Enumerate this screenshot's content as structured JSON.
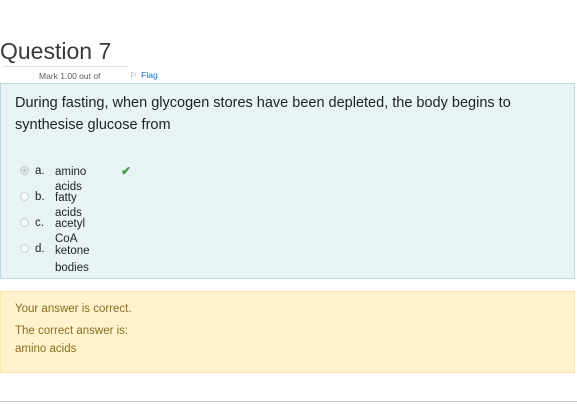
{
  "question": {
    "title": "Question 7",
    "mark": "Mark 1.00 out of",
    "flag_label": "Flag",
    "text": "During fasting, when glycogen stores have been depleted, the body begins to synthesise glucose from"
  },
  "answers": [
    {
      "letter": "a.",
      "text": "amino acids",
      "selected": true,
      "correct": true
    },
    {
      "letter": "b.",
      "text": "fatty acids",
      "selected": false
    },
    {
      "letter": "c.",
      "text": "acetyl CoA",
      "selected": false
    },
    {
      "letter": "d.",
      "text": "ketone bodies",
      "selected": false
    }
  ],
  "feedback": {
    "status": "Your answer is correct.",
    "correct_label": "The correct answer is:",
    "correct_value": "amino acids"
  },
  "colors": {
    "question_bg": "#e7f3f5",
    "feedback_bg": "#fff3cd",
    "feedback_text": "#8a6d1f",
    "check": "#3f9e3f",
    "link": "#0f6cbf"
  }
}
